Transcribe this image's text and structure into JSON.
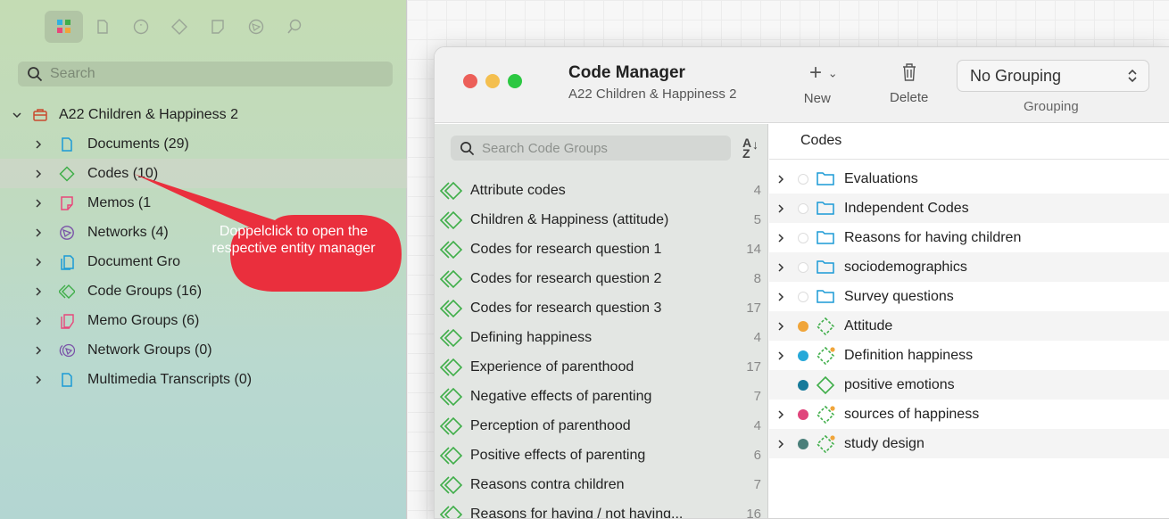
{
  "sidebar": {
    "toolbar": [
      "project-icon",
      "document-icon",
      "quotation-icon",
      "code-icon",
      "memo-icon",
      "network-icon",
      "search-icon"
    ],
    "search_placeholder": "Search",
    "project": "A22 Children & Happiness 2",
    "items": [
      {
        "label": "Documents (29)",
        "icon": "document-icon",
        "color": "#1a9ad6"
      },
      {
        "label": "Codes (10)",
        "icon": "code-icon",
        "color": "#3fae49"
      },
      {
        "label": "Memos (1",
        "icon": "memo-icon",
        "color": "#e8477a"
      },
      {
        "label": "Networks (4)",
        "icon": "network-icon",
        "color": "#7a52a8"
      },
      {
        "label": "Document Gro",
        "icon": "document-group-icon",
        "color": "#1a9ad6"
      },
      {
        "label": "Code Groups (16)",
        "icon": "code-group-icon",
        "color": "#3fae49"
      },
      {
        "label": "Memo Groups (6)",
        "icon": "memo-group-icon",
        "color": "#e8477a"
      },
      {
        "label": "Network Groups (0)",
        "icon": "network-group-icon",
        "color": "#7a52a8"
      },
      {
        "label": "Multimedia Transcripts (0)",
        "icon": "transcript-icon",
        "color": "#1a9ad6"
      }
    ]
  },
  "callout": {
    "text": "Doppelclick to open the respective entity manager",
    "color": "#ea2f3d"
  },
  "window": {
    "title": "Code Manager",
    "subtitle": "A22 Children & Happiness 2",
    "new_label": "New",
    "delete_label": "Delete",
    "grouping_value": "No Grouping",
    "grouping_label": "Grouping",
    "traffic_lights": [
      "#ec5f59",
      "#f4bf4f",
      "#2cc842"
    ]
  },
  "code_groups": {
    "search_placeholder": "Search Code Groups",
    "sort_label": "AZ",
    "rows": [
      {
        "label": "Attribute codes",
        "count": "4"
      },
      {
        "label": "Children & Happiness (attitude)",
        "count": "5"
      },
      {
        "label": "Codes for research question 1",
        "count": "14"
      },
      {
        "label": "Codes for research question 2",
        "count": "8"
      },
      {
        "label": "Codes for research question 3",
        "count": "17"
      },
      {
        "label": "Defining happiness",
        "count": "4"
      },
      {
        "label": "Experience of parenthood",
        "count": "17"
      },
      {
        "label": "Negative effects of parenting",
        "count": "7"
      },
      {
        "label": "Perception of parenthood",
        "count": "4"
      },
      {
        "label": "Positive effects of parenting",
        "count": "6"
      },
      {
        "label": "Reasons contra children",
        "count": "7"
      },
      {
        "label": "Reasons for having / not having...",
        "count": "16"
      }
    ]
  },
  "codes": {
    "header": "Codes",
    "rows": [
      {
        "label": "Evaluations",
        "kind": "folder",
        "dot": "",
        "chevron": true
      },
      {
        "label": "Independent Codes",
        "kind": "folder",
        "dot": "",
        "chevron": true
      },
      {
        "label": "Reasons for having children",
        "kind": "folder",
        "dot": "",
        "chevron": true
      },
      {
        "label": "sociodemographics",
        "kind": "folder",
        "dot": "",
        "chevron": true
      },
      {
        "label": "Survey questions",
        "kind": "folder",
        "dot": "",
        "chevron": true
      },
      {
        "label": "Attitude",
        "kind": "code-dashed",
        "dot": "#f0a53a",
        "chevron": true
      },
      {
        "label": "Definition happiness",
        "kind": "code-dashed-star",
        "dot": "#26a8d8",
        "chevron": true
      },
      {
        "label": "positive emotions",
        "kind": "code",
        "dot": "#167a9a",
        "chevron": false
      },
      {
        "label": "sources of happiness",
        "kind": "code-dashed-star",
        "dot": "#e0457c",
        "chevron": true
      },
      {
        "label": "study design",
        "kind": "code-dashed-star",
        "dot": "#4b7f7a",
        "chevron": true
      }
    ]
  }
}
